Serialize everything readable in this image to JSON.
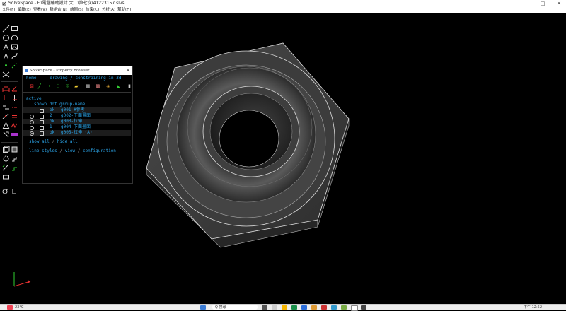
{
  "window": {
    "title": "SolveSpace - F:\\電腦輔助設計 大二\\第七次\\41223157.slvs",
    "minimize": "–",
    "maximize": "□",
    "close": "✕"
  },
  "menu": [
    "文件(F)",
    "編輯(E)",
    "查看(V)",
    "新組合(N)",
    "繪圖(S)",
    "約束(C)",
    "分析(A)",
    "幫助(H)"
  ],
  "property_browser": {
    "title": "SolveSpace - Property Browser",
    "close": "✕",
    "nav_home": "home",
    "nav_sep": "–",
    "nav_status": "drawing / constraining in 3d",
    "active_label": "active",
    "columns": "shown dof group-name",
    "groups": [
      {
        "type": "ok",
        "name": "g001-#參考"
      },
      {
        "type": "2",
        "name": "g002-下面畫面"
      },
      {
        "type": "ok",
        "name": "g003-拉伸"
      },
      {
        "type": "1",
        "name": "g004-下面畫面"
      },
      {
        "type": "ok",
        "name": "g005-拉伸 (A)"
      }
    ],
    "show_all": "show all",
    "hide_all": "hide all",
    "links_sep": "/",
    "line_styles": "line styles",
    "view": "view",
    "configuration": "configuration"
  },
  "taskbar": {
    "weather": "23°C",
    "search": "Q 搜尋",
    "time": "下午 12:52"
  },
  "colors": {
    "background": "#000000",
    "link": "#2ba3e6",
    "axis_x": "#e23030",
    "axis_y": "#30d030",
    "model_face": "#3c3c3c"
  }
}
